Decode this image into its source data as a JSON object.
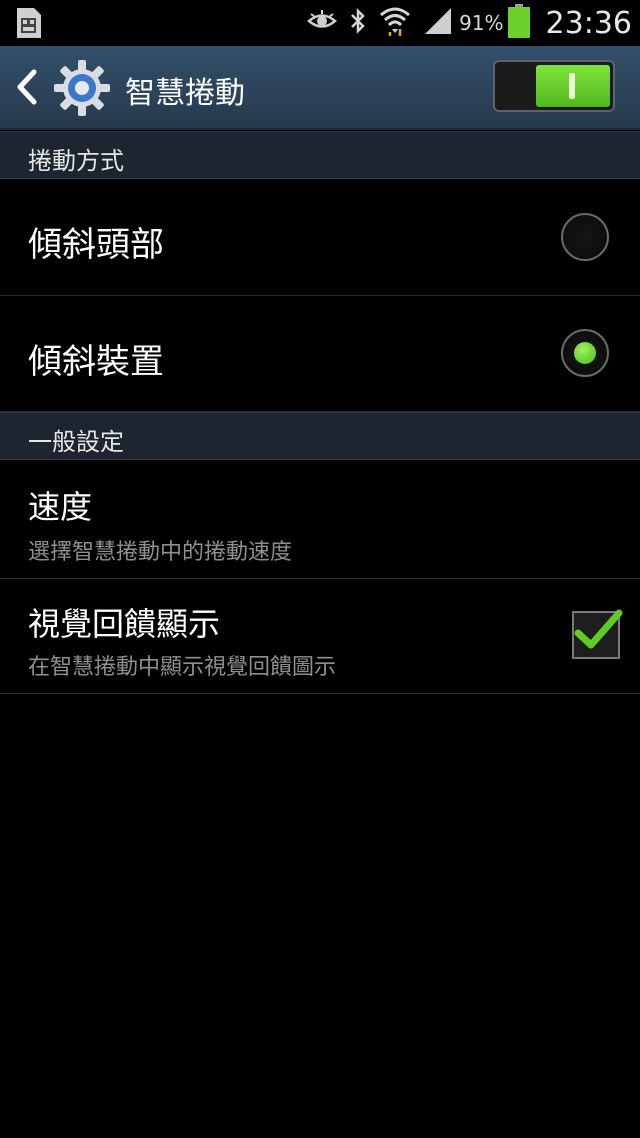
{
  "status_bar": {
    "battery_percent": "91%",
    "time": "23:36",
    "icons": [
      "sim-card-icon",
      "smart-scroll-eye-icon",
      "bluetooth-icon",
      "wifi-icon",
      "signal-icon",
      "battery-icon"
    ]
  },
  "action_bar": {
    "title": "智慧捲動",
    "back_icon": "chevron-left-icon",
    "app_icon": "gear-icon",
    "master_switch_on": true
  },
  "sections": {
    "scroll_method": {
      "header": "捲動方式",
      "options": [
        {
          "label": "傾斜頭部",
          "selected": false
        },
        {
          "label": "傾斜裝置",
          "selected": true
        }
      ]
    },
    "general": {
      "header": "一般設定",
      "speed": {
        "title": "速度",
        "subtitle": "選擇智慧捲動中的捲動速度"
      },
      "visual_feedback": {
        "title": "視覺回饋顯示",
        "subtitle": "在智慧捲動中顯示視覺回饋圖示",
        "checked": true
      }
    }
  },
  "colors": {
    "accent_green": "#5fcb24",
    "action_bar": "#2f4a62",
    "section_header": "#1c2530"
  }
}
